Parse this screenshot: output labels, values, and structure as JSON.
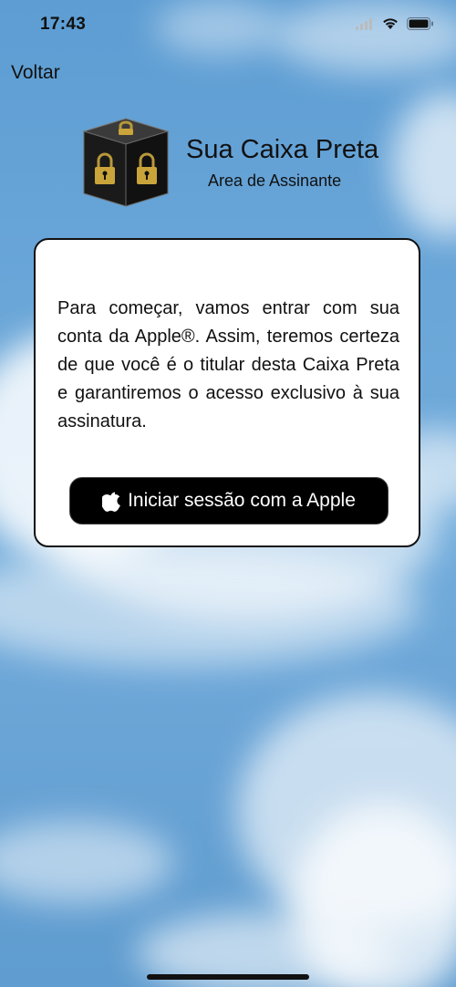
{
  "status_bar": {
    "time": "17:43",
    "icons": [
      "signal-icon",
      "wifi-icon",
      "battery-icon"
    ]
  },
  "nav": {
    "back_label": "Voltar"
  },
  "header": {
    "logo": "padlock-cube-logo",
    "title": "Sua Caixa Preta",
    "subtitle": "Area de Assinante"
  },
  "card": {
    "message": "Para começar, vamos entrar com sua conta da Apple®. Assim, teremos certeza de que você é o titular desta Caixa Preta e garantiremos o acesso exclusivo à sua assinatura.",
    "apple_button_label": "Iniciar sessão com a Apple",
    "apple_button_icon": "apple-icon"
  },
  "colors": {
    "sky": "#6aa6d8",
    "card_background": "#ffffff",
    "button_background": "#000000",
    "button_text": "#ffffff",
    "logo_gold": "#c9a43a"
  }
}
